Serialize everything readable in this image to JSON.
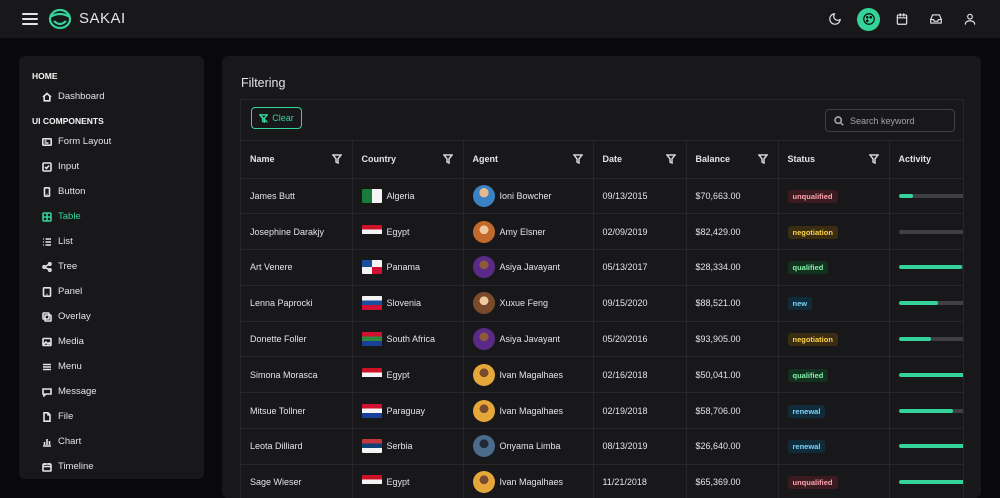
{
  "brand": {
    "name": "SAKAI"
  },
  "sidebar": {
    "sections": [
      {
        "title": "HOME",
        "items": [
          {
            "label": "Dashboard",
            "icon": "home-icon"
          }
        ]
      },
      {
        "title": "UI COMPONENTS",
        "items": [
          {
            "label": "Form Layout",
            "icon": "id-card-icon"
          },
          {
            "label": "Input",
            "icon": "check-square-icon"
          },
          {
            "label": "Button",
            "icon": "mobile-icon"
          },
          {
            "label": "Table",
            "icon": "table-icon",
            "active": true
          },
          {
            "label": "List",
            "icon": "list-icon"
          },
          {
            "label": "Tree",
            "icon": "share-alt-icon"
          },
          {
            "label": "Panel",
            "icon": "tablet-icon"
          },
          {
            "label": "Overlay",
            "icon": "clone-icon"
          },
          {
            "label": "Media",
            "icon": "image-icon"
          },
          {
            "label": "Menu",
            "icon": "bars-icon"
          },
          {
            "label": "Message",
            "icon": "comment-icon"
          },
          {
            "label": "File",
            "icon": "file-icon"
          },
          {
            "label": "Chart",
            "icon": "chart-bar-icon"
          },
          {
            "label": "Timeline",
            "icon": "calendar-icon"
          }
        ]
      }
    ]
  },
  "card": {
    "title": "Filtering"
  },
  "toolbar": {
    "clear_label": "Clear",
    "search_placeholder": "Search keyword"
  },
  "table": {
    "columns": [
      "Name",
      "Country",
      "Agent",
      "Date",
      "Balance",
      "Status",
      "Activity"
    ],
    "rows": [
      {
        "name": "James Butt",
        "country": "Algeria",
        "agent": "Ioni Bowcher",
        "date": "09/13/2015",
        "balance": "$70,663.00",
        "status": "unqualified",
        "activity": 0.2
      },
      {
        "name": "Josephine Darakjy",
        "country": "Egypt",
        "agent": "Amy Elsner",
        "date": "02/09/2019",
        "balance": "$82,429.00",
        "status": "negotiation",
        "activity": 0.0
      },
      {
        "name": "Art Venere",
        "country": "Panama",
        "agent": "Asiya Javayant",
        "date": "05/13/2017",
        "balance": "$28,334.00",
        "status": "qualified",
        "activity": 0.88
      },
      {
        "name": "Lenna Paprocki",
        "country": "Slovenia",
        "agent": "Xuxue Feng",
        "date": "09/15/2020",
        "balance": "$88,521.00",
        "status": "new",
        "activity": 0.55
      },
      {
        "name": "Donette Foller",
        "country": "South Africa",
        "agent": "Asiya Javayant",
        "date": "05/20/2016",
        "balance": "$93,905.00",
        "status": "negotiation",
        "activity": 0.45
      },
      {
        "name": "Simona Morasca",
        "country": "Egypt",
        "agent": "Ivan Magalhaes",
        "date": "02/16/2018",
        "balance": "$50,041.00",
        "status": "qualified",
        "activity": 1.0
      },
      {
        "name": "Mitsue Tollner",
        "country": "Paraguay",
        "agent": "Ivan Magalhaes",
        "date": "02/19/2018",
        "balance": "$58,706.00",
        "status": "renewal",
        "activity": 0.75
      },
      {
        "name": "Leota Dilliard",
        "country": "Serbia",
        "agent": "Onyama Limba",
        "date": "08/13/2019",
        "balance": "$26,640.00",
        "status": "renewal",
        "activity": 1.0
      },
      {
        "name": "Sage Wieser",
        "country": "Egypt",
        "agent": "Ivan Magalhaes",
        "date": "11/21/2018",
        "balance": "$65,369.00",
        "status": "unqualified",
        "activity": 1.0
      }
    ]
  },
  "colors": {
    "accent": "#34d399",
    "status": {
      "unqualified": "#fda4af",
      "negotiation": "#fcd34d",
      "qualified": "#86efac",
      "new": "#7dd3fc",
      "renewal": "#7dd3fc"
    },
    "status_bg": {
      "unqualified": "#3b1a20",
      "negotiation": "#3a2d12",
      "qualified": "#12311f",
      "new": "#102c3a",
      "renewal": "#102c3a"
    }
  }
}
